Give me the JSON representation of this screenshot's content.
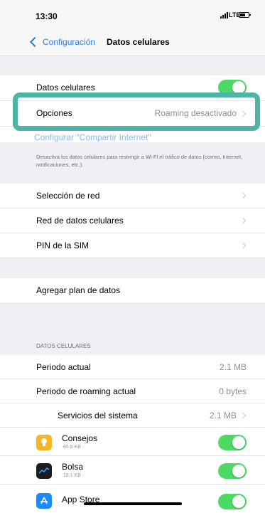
{
  "status_bar": {
    "time": "13:30",
    "network": "LTE"
  },
  "nav": {
    "back_label": "Configuración",
    "title": "Datos celulares"
  },
  "rows": {
    "datos_celulares": {
      "label": "Datos celulares",
      "toggle_on": true
    },
    "opciones": {
      "label": "Opciones",
      "value": "Roaming desactivado"
    },
    "compartir": {
      "label": "Configurar \"Compartir Internet\""
    },
    "footer_note": "Desactiva los datos celulares para restringir a Wi-Fi el tráfico de datos (correo, Internet, notificaciones, etc.).",
    "seleccion_red": {
      "label": "Selección de red"
    },
    "red_datos": {
      "label": "Red de datos celulares"
    },
    "pin_sim": {
      "label": "PIN de la SIM"
    },
    "agregar_plan": {
      "label": "Agregar plan de datos"
    }
  },
  "usage": {
    "section_header": "DATOS CELULARES",
    "periodo_actual": {
      "label": "Periodo actual",
      "value": "2.1 MB"
    },
    "periodo_roaming": {
      "label": "Periodo de roaming actual",
      "value": "0 bytes"
    },
    "servicios": {
      "label": "Servicios del sistema",
      "value": "2.1 MB"
    },
    "apps": [
      {
        "name": "Consejos",
        "size": "65.8 KB",
        "icon": "lightbulb-icon",
        "color": "#f5b623",
        "enabled": true
      },
      {
        "name": "Bolsa",
        "size": "18.1 KB",
        "icon": "stocks-icon",
        "color": "#1c1c1e",
        "enabled": true
      },
      {
        "name": "App Store",
        "size": "",
        "icon": "app-store-icon",
        "color": "#1a8cff",
        "enabled": true
      }
    ]
  },
  "colors": {
    "accent": "#2b7de9",
    "toggle_on": "#4cd964",
    "highlight": "#4fb4a8"
  }
}
